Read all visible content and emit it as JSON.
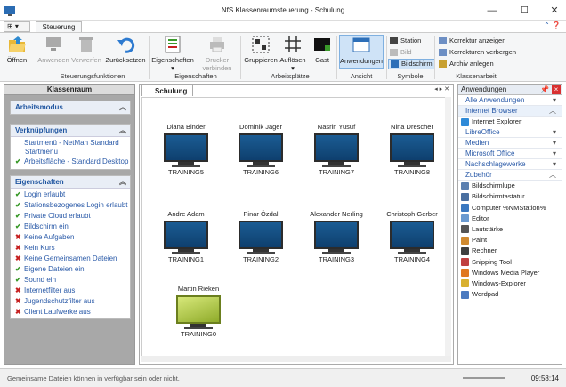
{
  "window": {
    "title": "NfS Klassenraumsteuerung - Schulung"
  },
  "tabs": {
    "quick": "⊞ ▾",
    "active": "Steuerung"
  },
  "ribbon": {
    "groups": [
      {
        "label": "Steuerungsfunktionen"
      },
      {
        "label": "Eigenschaften"
      },
      {
        "label": "Arbeitsplätze"
      },
      {
        "label": "Ansicht"
      },
      {
        "label": "Symbole"
      },
      {
        "label": "Klassenarbeit"
      }
    ],
    "buttons": {
      "open": "Öffnen",
      "apply": "Anwenden",
      "discard": "Verwerfen",
      "reset": "Zurücksetzen",
      "properties": "Eigenschaften",
      "printer": "Drucker verbinden",
      "group": "Gruppieren",
      "ungroup": "Auflösen",
      "guest": "Gast",
      "apps": "Anwendungen"
    },
    "symbols": [
      "Station",
      "Bild",
      "Bildschirm"
    ],
    "exam": [
      "Korrektur anzeigen",
      "Korrekturen verbergen",
      "Archiv anlegen"
    ]
  },
  "left": {
    "title": "Klassenraum",
    "mode": "Arbeitsmodus",
    "links_title": "Verknüpfungen",
    "links": [
      {
        "text": "Startmenü - NetMan Standard Startmenü",
        "ok": true
      },
      {
        "text": "Arbeitsfläche - Standard Desktop",
        "ok": true
      }
    ],
    "props_title": "Eigenschaften",
    "props": [
      {
        "text": "Login erlaubt",
        "ok": true
      },
      {
        "text": "Stationsbezogenes Login erlaubt",
        "ok": true
      },
      {
        "text": "Private Cloud erlaubt",
        "ok": true
      },
      {
        "text": "Bildschirm ein",
        "ok": true
      },
      {
        "text": "Keine Aufgaben",
        "ok": false
      },
      {
        "text": "Kein Kurs",
        "ok": false
      },
      {
        "text": "Keine Gemeinsamen Dateien",
        "ok": false
      },
      {
        "text": "Eigene Dateien ein",
        "ok": true
      },
      {
        "text": "Sound ein",
        "ok": true
      },
      {
        "text": "Internetfilter aus",
        "ok": false
      },
      {
        "text": "Jugendschutzfilter aus",
        "ok": false
      },
      {
        "text": "Client Laufwerke aus",
        "ok": false
      }
    ]
  },
  "center": {
    "tab": "Schulung",
    "stations": [
      {
        "user": "Diana Binder",
        "name": "TRAINING5"
      },
      {
        "user": "Dominik Jäger",
        "name": "TRAINING6"
      },
      {
        "user": "Nasrin Yusuf",
        "name": "TRAINING7"
      },
      {
        "user": "Nina Drescher",
        "name": "TRAINING8"
      },
      {
        "user": "Andre Adam",
        "name": "TRAINING1"
      },
      {
        "user": "Pinar Özdal",
        "name": "TRAINING2"
      },
      {
        "user": "Alexander Nerling",
        "name": "TRAINING3"
      },
      {
        "user": "Christoph Gerber",
        "name": "TRAINING4"
      },
      {
        "user": "Martin Rieken",
        "name": "TRAINING0"
      }
    ]
  },
  "right": {
    "title": "Anwendungen",
    "categories_top": [
      "Alle Anwendungen",
      "Internet Browser"
    ],
    "browser_app": "Internet Explorer",
    "categories": [
      "LibreOffice",
      "Medien",
      "Microsoft Office",
      "Nachschlagewerke",
      "Zubehör"
    ],
    "apps": [
      "Bildschirmlupe",
      "Bildschirmtastatur",
      "Computer %NMStation%",
      "Editor",
      "Lautstärke",
      "Paint",
      "Rechner",
      "Snipping Tool",
      "Windows Media Player",
      "Windows-Explorer",
      "Wordpad"
    ]
  },
  "status": {
    "message": "Gemeinsame Dateien können in  verfügbar sein oder nicht.",
    "time": "09:58:14"
  }
}
